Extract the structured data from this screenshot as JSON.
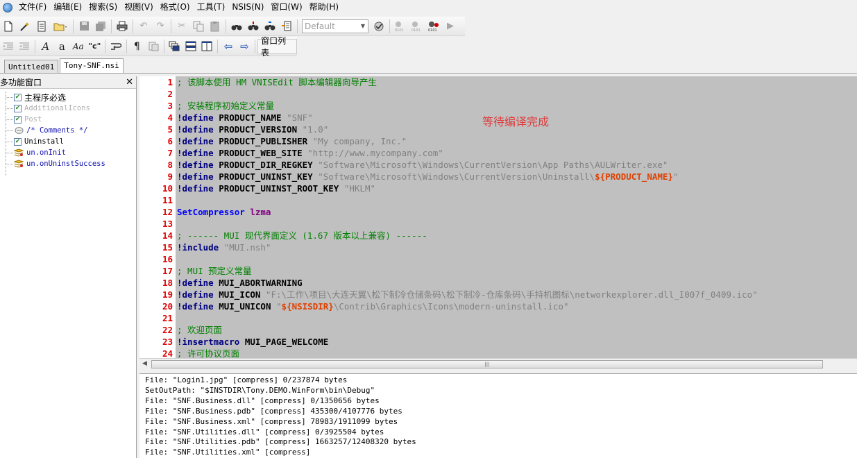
{
  "menu": [
    "文件(F)",
    "编辑(E)",
    "搜索(S)",
    "视图(V)",
    "格式(O)",
    "工具(T)",
    "NSIS(N)",
    "窗口(W)",
    "帮助(H)"
  ],
  "toolbar": {
    "style_combo_value": "Default",
    "window_list_label": "窗口列表",
    "format_labels": [
      "A",
      "a",
      "Aa",
      "\"c\""
    ]
  },
  "tabs": [
    {
      "label": "Untitled01",
      "active": false
    },
    {
      "label": "Tony-SNF.nsi",
      "active": true
    }
  ],
  "panel": {
    "title": "多功能窗口",
    "close": "✕",
    "items": [
      {
        "label": "主程序必选",
        "kind": "checked",
        "style": "normal"
      },
      {
        "label": "AdditionalIcons",
        "kind": "checked",
        "style": "gray"
      },
      {
        "label": "Post",
        "kind": "checked",
        "style": "gray"
      },
      {
        "label": "/* Comments */",
        "kind": "comment",
        "style": "blue"
      },
      {
        "label": "Uninstall",
        "kind": "checked",
        "style": "normal"
      },
      {
        "label": "un.onInit",
        "kind": "function",
        "style": "blue"
      },
      {
        "label": "un.onUninstSuccess",
        "kind": "function",
        "style": "blue"
      }
    ]
  },
  "editor": {
    "status_overlay": "等待编译完成",
    "lines": [
      {
        "n": "1",
        "parts": [
          {
            "t": "; 该脚本使用 HM VNISEdit 脚本编辑器向导产生",
            "c": "comment"
          }
        ]
      },
      {
        "n": "2",
        "parts": []
      },
      {
        "n": "3",
        "parts": [
          {
            "t": "; 安装程序初始定义常量",
            "c": "comment"
          }
        ]
      },
      {
        "n": "4",
        "parts": [
          {
            "t": "!define ",
            "c": "kw"
          },
          {
            "t": "PRODUCT_NAME ",
            "c": "plain"
          },
          {
            "t": "\"SNF\"",
            "c": "str"
          }
        ]
      },
      {
        "n": "5",
        "parts": [
          {
            "t": "!define ",
            "c": "kw"
          },
          {
            "t": "PRODUCT_VERSION ",
            "c": "plain"
          },
          {
            "t": "\"1.0\"",
            "c": "str"
          }
        ]
      },
      {
        "n": "6",
        "parts": [
          {
            "t": "!define ",
            "c": "kw"
          },
          {
            "t": "PRODUCT_PUBLISHER ",
            "c": "plain"
          },
          {
            "t": "\"My company, Inc.\"",
            "c": "str"
          }
        ]
      },
      {
        "n": "7",
        "parts": [
          {
            "t": "!define ",
            "c": "kw"
          },
          {
            "t": "PRODUCT_WEB_SITE ",
            "c": "plain"
          },
          {
            "t": "\"http://www.mycompany.com\"",
            "c": "str"
          }
        ]
      },
      {
        "n": "8",
        "parts": [
          {
            "t": "!define ",
            "c": "kw"
          },
          {
            "t": "PRODUCT_DIR_REGKEY ",
            "c": "plain"
          },
          {
            "t": "\"Software\\Microsoft\\Windows\\CurrentVersion\\App Paths\\AULWriter.exe\"",
            "c": "str"
          }
        ]
      },
      {
        "n": "9",
        "parts": [
          {
            "t": "!define ",
            "c": "kw"
          },
          {
            "t": "PRODUCT_UNINST_KEY ",
            "c": "plain"
          },
          {
            "t": "\"Software\\Microsoft\\Windows\\CurrentVersion\\Uninstall\\",
            "c": "str"
          },
          {
            "t": "${PRODUCT_NAME}",
            "c": "var"
          },
          {
            "t": "\"",
            "c": "str"
          }
        ]
      },
      {
        "n": "10",
        "parts": [
          {
            "t": "!define ",
            "c": "kw"
          },
          {
            "t": "PRODUCT_UNINST_ROOT_KEY ",
            "c": "plain"
          },
          {
            "t": "\"HKLM\"",
            "c": "str"
          }
        ]
      },
      {
        "n": "11",
        "parts": []
      },
      {
        "n": "12",
        "parts": [
          {
            "t": "SetCompressor ",
            "c": "fn"
          },
          {
            "t": "lzma",
            "c": "pur"
          }
        ]
      },
      {
        "n": "13",
        "parts": []
      },
      {
        "n": "14",
        "parts": [
          {
            "t": "; ------ MUI 现代界面定义 (1.67 版本以上兼容) ------",
            "c": "comment"
          }
        ]
      },
      {
        "n": "15",
        "parts": [
          {
            "t": "!include ",
            "c": "kw"
          },
          {
            "t": "\"MUI.nsh\"",
            "c": "str"
          }
        ]
      },
      {
        "n": "16",
        "parts": []
      },
      {
        "n": "17",
        "parts": [
          {
            "t": "; MUI 预定义常量",
            "c": "comment"
          }
        ]
      },
      {
        "n": "18",
        "parts": [
          {
            "t": "!define ",
            "c": "kw"
          },
          {
            "t": "MUI_ABORTWARNING",
            "c": "plain"
          }
        ]
      },
      {
        "n": "19",
        "parts": [
          {
            "t": "!define ",
            "c": "kw"
          },
          {
            "t": "MUI_ICON ",
            "c": "plain"
          },
          {
            "t": "\"F:\\工作\\项目\\大连天翼\\松下制冷仓储条码\\松下制冷-仓库条码\\手持机图标\\networkexplorer.dll_I007f_0409.ico\"",
            "c": "str"
          }
        ]
      },
      {
        "n": "20",
        "parts": [
          {
            "t": "!define ",
            "c": "kw"
          },
          {
            "t": "MUI_UNICON ",
            "c": "plain"
          },
          {
            "t": "\"",
            "c": "str"
          },
          {
            "t": "${NSISDIR}",
            "c": "var"
          },
          {
            "t": "\\Contrib\\Graphics\\Icons\\modern-uninstall.ico\"",
            "c": "str"
          }
        ]
      },
      {
        "n": "21",
        "parts": []
      },
      {
        "n": "22",
        "parts": [
          {
            "t": "; 欢迎页面",
            "c": "comment"
          }
        ]
      },
      {
        "n": "23",
        "parts": [
          {
            "t": "!insertmacro ",
            "c": "kw"
          },
          {
            "t": "MUI_PAGE_WELCOME",
            "c": "plain"
          }
        ]
      },
      {
        "n": "24",
        "parts": [
          {
            "t": "; 许可协议页面",
            "c": "comment"
          }
        ]
      }
    ]
  },
  "scrollbar": {
    "left_arrow": "◀",
    "grip": "|||"
  },
  "output": [
    "File: \"Login1.jpg\" [compress] 0/237874 bytes",
    "SetOutPath: \"$INSTDIR\\Tony.DEMO.WinForm\\bin\\Debug\"",
    "File: \"SNF.Business.dll\" [compress] 0/1350656 bytes",
    "File: \"SNF.Business.pdb\" [compress] 435300/4107776 bytes",
    "File: \"SNF.Business.xml\" [compress] 78983/1911099 bytes",
    "File: \"SNF.Utilities.dll\" [compress] 0/3925504 bytes",
    "File: \"SNF.Utilities.pdb\" [compress] 1663257/12408320 bytes",
    "File: \"SNF.Utilities.xml\" [compress]"
  ]
}
